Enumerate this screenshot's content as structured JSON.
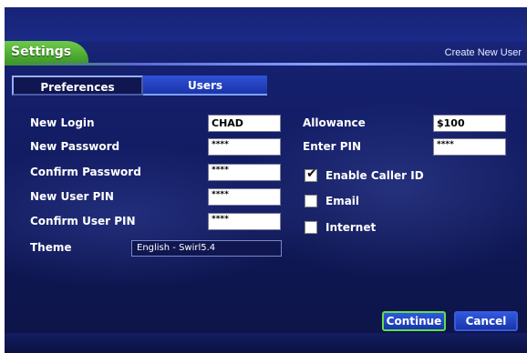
{
  "header": {
    "title_tab": "Settings",
    "context_title": "Create New User"
  },
  "tabs": [
    {
      "label": "Preferences"
    },
    {
      "label": "Users"
    }
  ],
  "form": {
    "new_login": {
      "label": "New Login",
      "value": "CHAD"
    },
    "new_password": {
      "label": "New Password",
      "value": "****"
    },
    "confirm_password": {
      "label": "Confirm Password",
      "value": "****"
    },
    "new_user_pin": {
      "label": "New User PIN",
      "value": "****"
    },
    "confirm_user_pin": {
      "label": "Confirm User PIN",
      "value": "****"
    },
    "theme": {
      "label": "Theme",
      "value": "English - Swirl5.4"
    },
    "allowance": {
      "label": "Allowance",
      "value": "$100"
    },
    "enter_pin": {
      "label": "Enter PIN",
      "value": "****"
    },
    "options": [
      {
        "label": "Enable Caller ID",
        "checked": true
      },
      {
        "label": "Email",
        "checked": false
      },
      {
        "label": "Internet",
        "checked": false
      }
    ]
  },
  "buttons": {
    "continue": "Continue",
    "cancel": "Cancel"
  },
  "colors": {
    "accent_green": "#4fb832",
    "background_navy": "#111a5c",
    "button_blue": "#2448c8"
  }
}
